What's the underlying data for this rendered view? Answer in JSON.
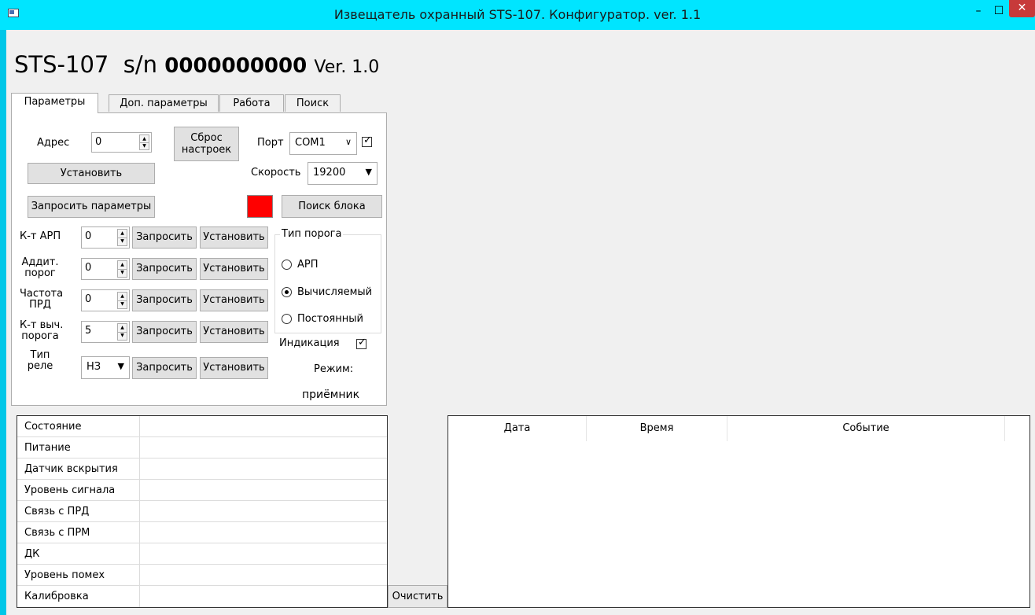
{
  "window": {
    "title": "Извещатель охранный STS-107. Конфигуратор. ver. 1.1",
    "controls": {
      "minimize": "–",
      "maximize": "☐",
      "close": "✕"
    }
  },
  "header": {
    "model": "STS-107",
    "sn_label": "s/n",
    "sn_value": "0000000000",
    "version": "Ver. 1.0"
  },
  "tabs": [
    "Параметры",
    "Доп. параметры",
    "Работа",
    "Поиск"
  ],
  "params": {
    "address_label": "Адрес",
    "address_value": "0",
    "reset_label_1": "Сброс",
    "reset_label_2": "настроек",
    "port_label": "Порт",
    "port_value": "COM1",
    "port_checked": true,
    "set_label": "Установить",
    "speed_label": "Скорость",
    "speed_value": "19200",
    "request_params_label": "Запросить параметры",
    "find_block_label": "Поиск блока",
    "indicator_color": "#ff0000",
    "request_btn": "Запросить",
    "set_btn": "Установить",
    "rows": [
      {
        "label": [
          "К-т АРП"
        ],
        "value": "0"
      },
      {
        "label": [
          "Аддит.",
          "порог"
        ],
        "value": "0"
      },
      {
        "label": [
          "Частота",
          "ПРД"
        ],
        "value": "0"
      },
      {
        "label": [
          "К-т выч.",
          "порога"
        ],
        "value": "5"
      }
    ],
    "relay": {
      "label": [
        "Тип",
        "реле"
      ],
      "value": "НЗ"
    },
    "threshold_group": {
      "title": "Тип порога",
      "options": [
        "АРП",
        "Вычисляемый",
        "Постоянный"
      ],
      "selected": "Вычисляемый"
    },
    "indication_label": "Индикация",
    "indication_checked": true,
    "mode_label": "Режим:",
    "mode_value": "приёмник"
  },
  "status": {
    "rows": [
      "Состояние",
      "Питание",
      "Датчик вскрытия",
      "Уровень сигнала",
      "Связь с ПРД",
      "Связь с ПРМ",
      "ДК",
      "Уровень помех",
      "Калибровка"
    ]
  },
  "clear_label": "Очистить",
  "events": {
    "columns": [
      "Дата",
      "Время",
      "Событие"
    ]
  }
}
